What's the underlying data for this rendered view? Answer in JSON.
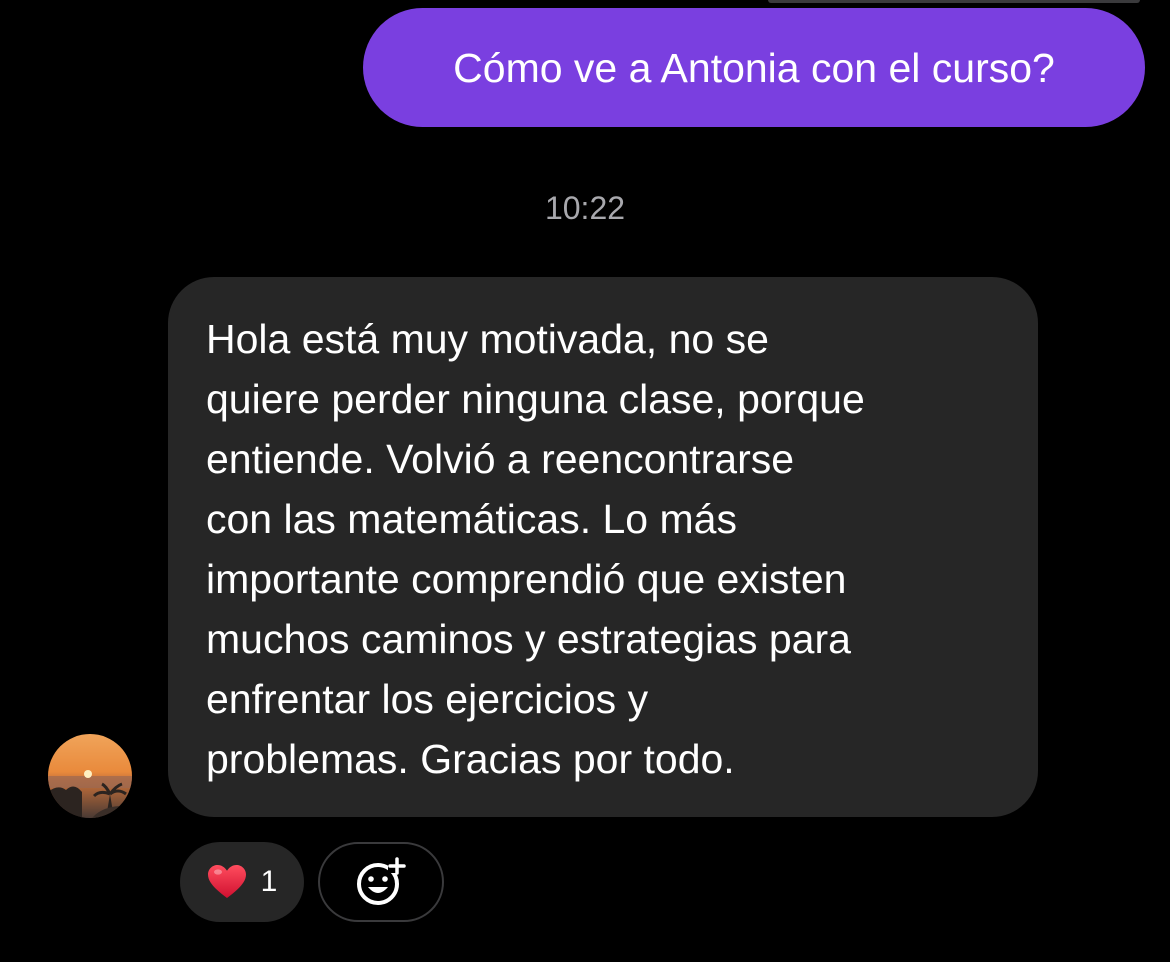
{
  "conversation": {
    "sent_message": "Cómo ve a Antonia con el curso?",
    "timestamp": "10:22",
    "received_message": "Hola está muy motivada, no se\nquiere perder ninguna clase, porque\nentiende. Volvió a reencontrarse\ncon las matemáticas. Lo más\nimportante comprendió que existen\nmuchos caminos y estrategias para\nenfrentar los ejercicios y\nproblemas. Gracias por todo.",
    "reaction": {
      "icon": "heart-icon",
      "count": "1"
    },
    "add_reaction_icon": "smiley-plus-icon",
    "avatar_icon": "sunset-avatar"
  },
  "colors": {
    "background": "#000000",
    "sent_bubble": "#7a3fe0",
    "received_bubble": "#262626",
    "timestamp_text": "#a8a8ad",
    "heart": "#e0193a"
  }
}
